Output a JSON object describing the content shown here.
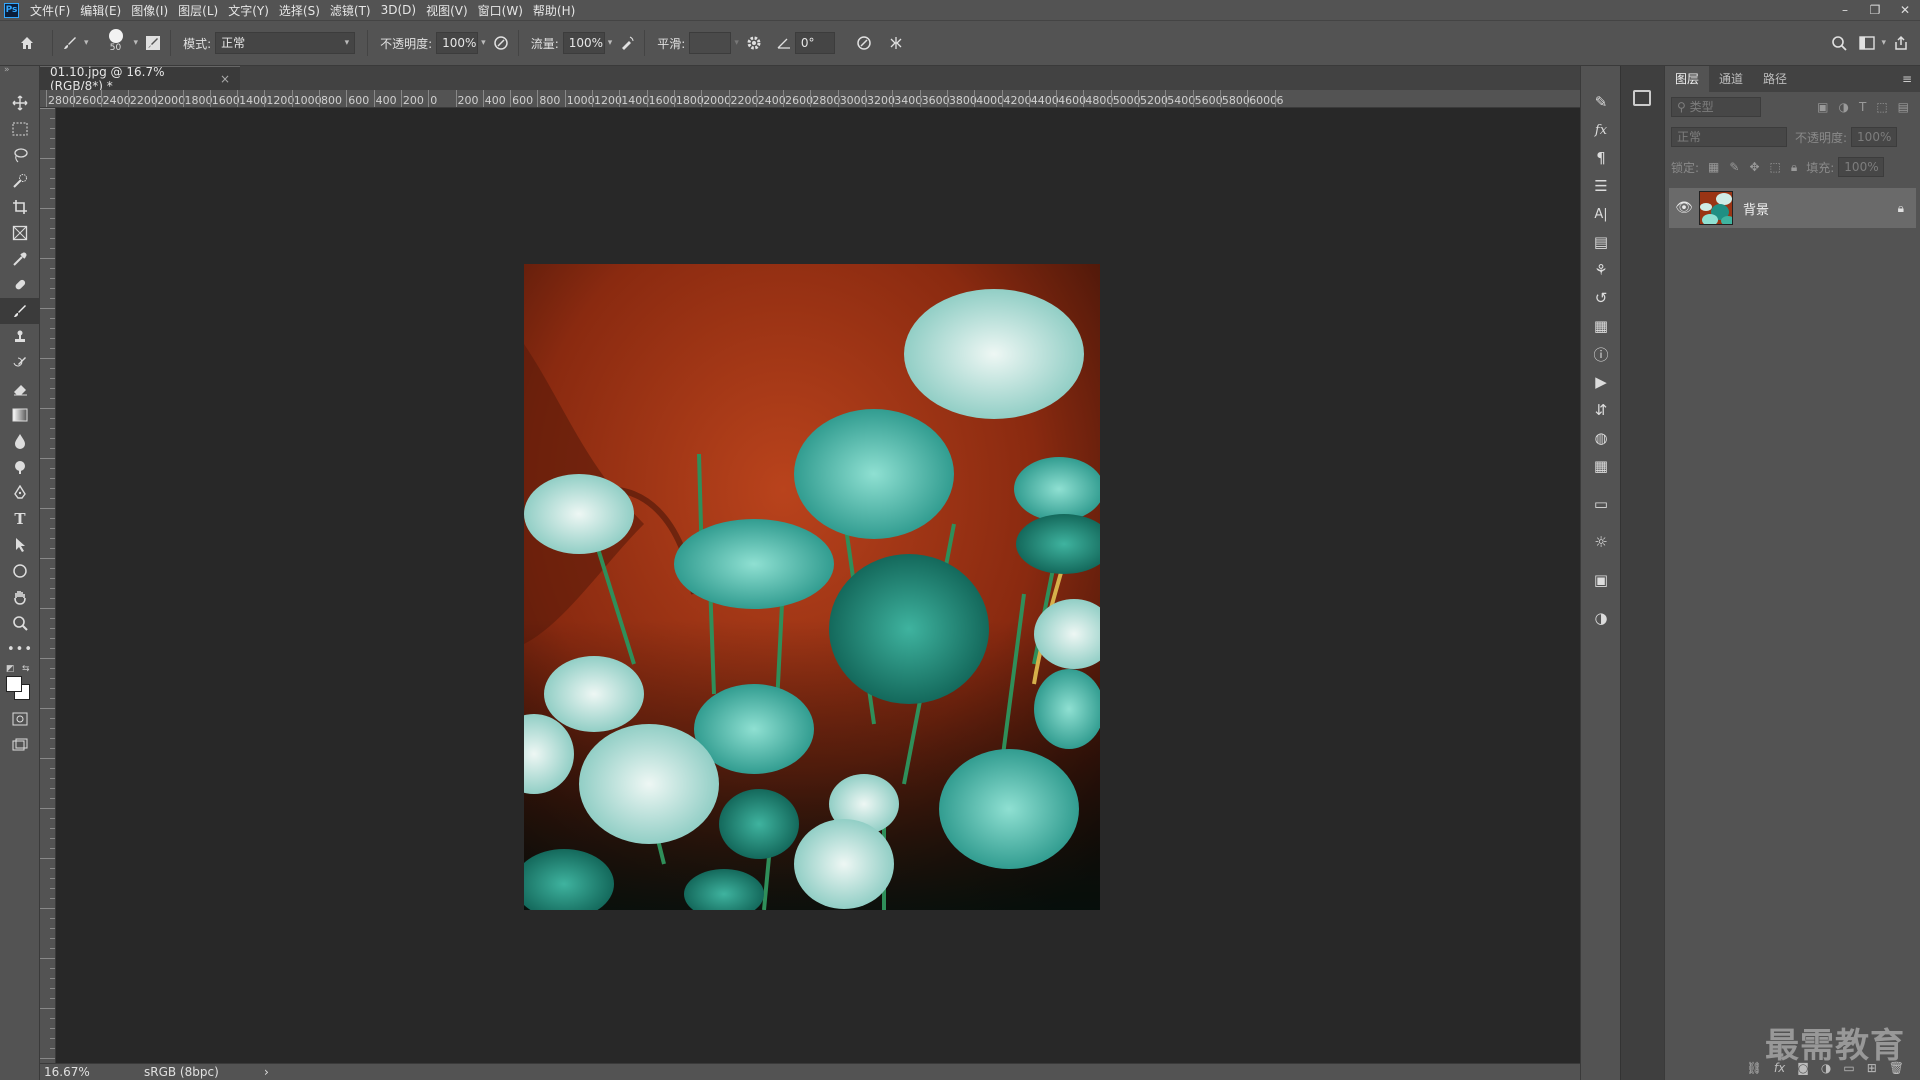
{
  "app": {
    "logo": "Ps"
  },
  "menu": [
    "文件(F)",
    "编辑(E)",
    "图像(I)",
    "图层(L)",
    "文字(Y)",
    "选择(S)",
    "滤镜(T)",
    "3D(D)",
    "视图(V)",
    "窗口(W)",
    "帮助(H)"
  ],
  "window_controls": {
    "minimize": "–",
    "restore": "❐",
    "close": "✕"
  },
  "options": {
    "brush_size": "50",
    "mode_label": "模式:",
    "mode_value": "正常",
    "opacity_label": "不透明度:",
    "opacity_value": "100%",
    "flow_label": "流量:",
    "flow_value": "100%",
    "smoothing_label": "平滑:",
    "smoothing_value": "",
    "angle_value": "0°"
  },
  "document": {
    "tab_title": "01.10.jpg @ 16.7%(RGB/8*) *",
    "tab_close": "×"
  },
  "ruler": {
    "h_labels": [
      "2800",
      "2600",
      "2400",
      "2200",
      "2000",
      "1800",
      "1600",
      "1400",
      "1200",
      "1000",
      "800",
      "600",
      "400",
      "200",
      "0",
      "200",
      "400",
      "600",
      "800",
      "1000",
      "1200",
      "1400",
      "1600",
      "1800",
      "2000",
      "2200",
      "2400",
      "2600",
      "2800",
      "3000",
      "3200",
      "3400",
      "3600",
      "3800",
      "4000",
      "4200",
      "4400",
      "4600",
      "4800",
      "5000",
      "5200",
      "5400",
      "5600",
      "5800",
      "6000",
      "6"
    ]
  },
  "status": {
    "zoom": "16.67%",
    "color_profile": "sRGB (8bpc)",
    "arrow": "›"
  },
  "layers_panel": {
    "tabs": [
      "图层",
      "通道",
      "路径"
    ],
    "filter_placeholder": "类型",
    "blend_mode": "正常",
    "opacity_label": "不透明度:",
    "opacity_value": "100%",
    "lock_label": "锁定:",
    "fill_label": "填充:",
    "fill_value": "100%",
    "layers": [
      {
        "name": "背景",
        "visible": true,
        "locked": true
      }
    ]
  },
  "watermark": "最需教育",
  "colors": {
    "ui_panel": "#535353",
    "canvas_bg": "#282828",
    "accent": "#31a8ff"
  }
}
